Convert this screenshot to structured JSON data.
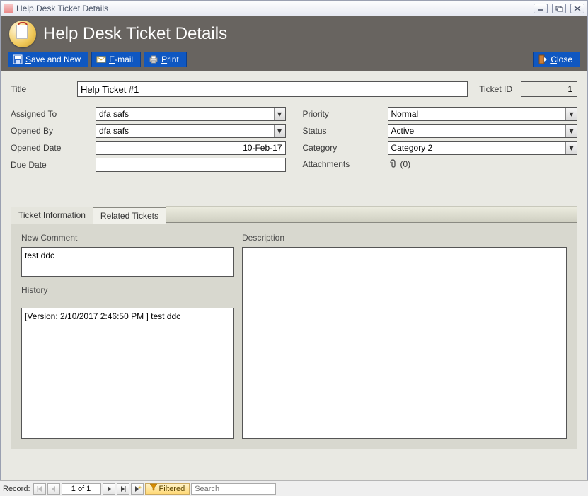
{
  "window": {
    "title": "Help Desk Ticket Details"
  },
  "header": {
    "title": "Help Desk Ticket Details",
    "buttons": {
      "save_prefix": "S",
      "save_rest": "ave and New",
      "email_prefix": "E",
      "email_rest": "-mail",
      "print_prefix": "P",
      "print_rest": "rint",
      "close_prefix": "C",
      "close_rest": "lose"
    }
  },
  "form": {
    "title_label": "Title",
    "title_value": "Help Ticket #1",
    "ticket_id_label": "Ticket ID",
    "ticket_id_value": "1",
    "left": {
      "assigned_to_label": "Assigned To",
      "assigned_to_value": "dfa safs",
      "opened_by_label": "Opened By",
      "opened_by_value": "dfa safs",
      "opened_date_label": "Opened Date",
      "opened_date_value": "10-Feb-17",
      "due_date_label": "Due Date",
      "due_date_value": ""
    },
    "right": {
      "priority_label": "Priority",
      "priority_value": "Normal",
      "status_label": "Status",
      "status_value": "Active",
      "category_label": "Category",
      "category_value": "Category 2",
      "attachments_label": "Attachments",
      "attachments_value": "(0)"
    }
  },
  "tabs": {
    "tab1": "Ticket Information",
    "tab2": "Related Tickets",
    "new_comment_label": "New Comment",
    "new_comment_value": "test ddc",
    "history_label": "History",
    "history_value": "[Version:  2/10/2017 2:46:50 PM ] test ddc",
    "description_label": "Description",
    "description_value": ""
  },
  "recordbar": {
    "label": "Record:",
    "position": "1 of 1",
    "filtered": "Filtered",
    "search_placeholder": "Search"
  }
}
